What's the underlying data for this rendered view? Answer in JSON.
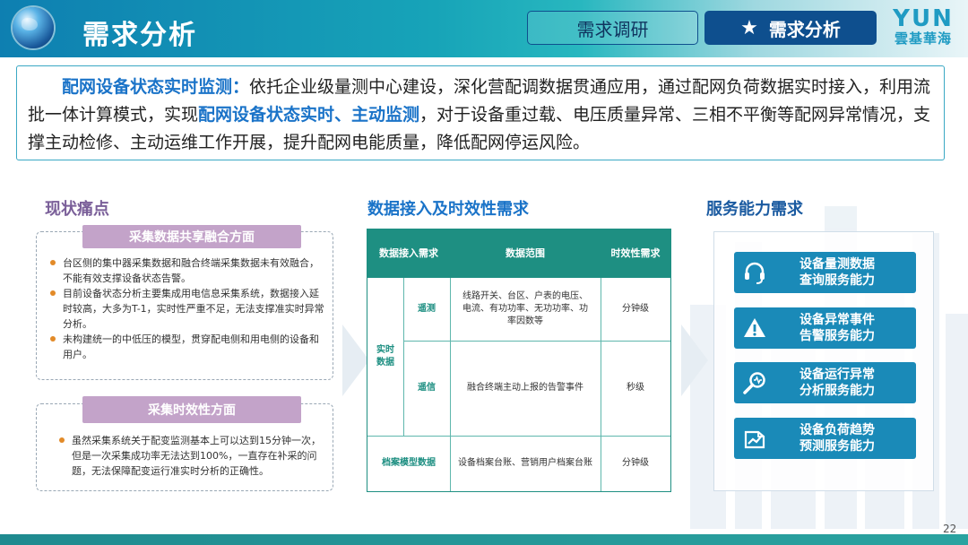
{
  "header": {
    "title": "需求分析",
    "tabs": [
      {
        "label": "需求调研",
        "active": false
      },
      {
        "label": "需求分析",
        "active": true
      }
    ],
    "logo_main": "YUN",
    "logo_sub": "雲基華海"
  },
  "intro": {
    "lead": "配网设备状态实时监测：",
    "text1": "依托企业级量测中心建设，深化营配调数据贯通应用，通过配网负荷数据实时接入，利用流批一体计算模式，实现",
    "highlight2": "配网设备状态实时、主动监测",
    "text2": "，对于设备重过载、电压质量异常、三相不平衡等配网异常情况，支撑主动检修、主动运维工作开展，提升配网电能质量，降低配网停运风险。"
  },
  "pain": {
    "heading": "现状痛点",
    "group1": {
      "title": "采集数据共享融合方面",
      "items": [
        "台区侧的集中器采集数据和融合终端采集数据未有效融合，不能有效支撑设备状态告警。",
        "目前设备状态分析主要集成用电信息采集系统，数据接入延时较高，大多为T-1，实时性严重不足，无法支撑准实时异常分析。",
        "未构建统一的中低压的模型，贯穿配电侧和用电侧的设备和用户。"
      ]
    },
    "group2": {
      "title": "采集时效性方面",
      "items": [
        "虽然采集系统关于配变监测基本上可以达到15分钟一次，但是一次采集成功率无法达到100%，一直存在补采的问题，无法保障配变运行准实时分析的正确性。"
      ]
    }
  },
  "data_req": {
    "heading": "数据接入及时效性需求",
    "headers": [
      "数据接入需求",
      "数据范围",
      "时效性需求"
    ],
    "group_label": "实时数据",
    "rows": [
      {
        "sub": "遥测",
        "scope": "线路开关、台区、户表的电压、电流、有功功率、无功功率、功率因数等",
        "time": "分钟级"
      },
      {
        "sub": "遥信",
        "scope": "融合终端主动上报的告警事件",
        "time": "秒级"
      },
      {
        "sub": "档案模型数据",
        "scope": "设备档案台账、营销用户档案台账",
        "time": "分钟级"
      }
    ]
  },
  "service": {
    "heading": "服务能力需求",
    "items": [
      {
        "icon": "headset-icon",
        "line1": "设备量测数据",
        "line2": "查询服务能力"
      },
      {
        "icon": "warning-icon",
        "line1": "设备异常事件",
        "line2": "告警服务能力"
      },
      {
        "icon": "magnifier-icon",
        "line1": "设备运行异常",
        "line2": "分析服务能力"
      },
      {
        "icon": "trend-icon",
        "line1": "设备负荷趋势",
        "line2": "预测服务能力"
      }
    ]
  },
  "page_number": "22"
}
